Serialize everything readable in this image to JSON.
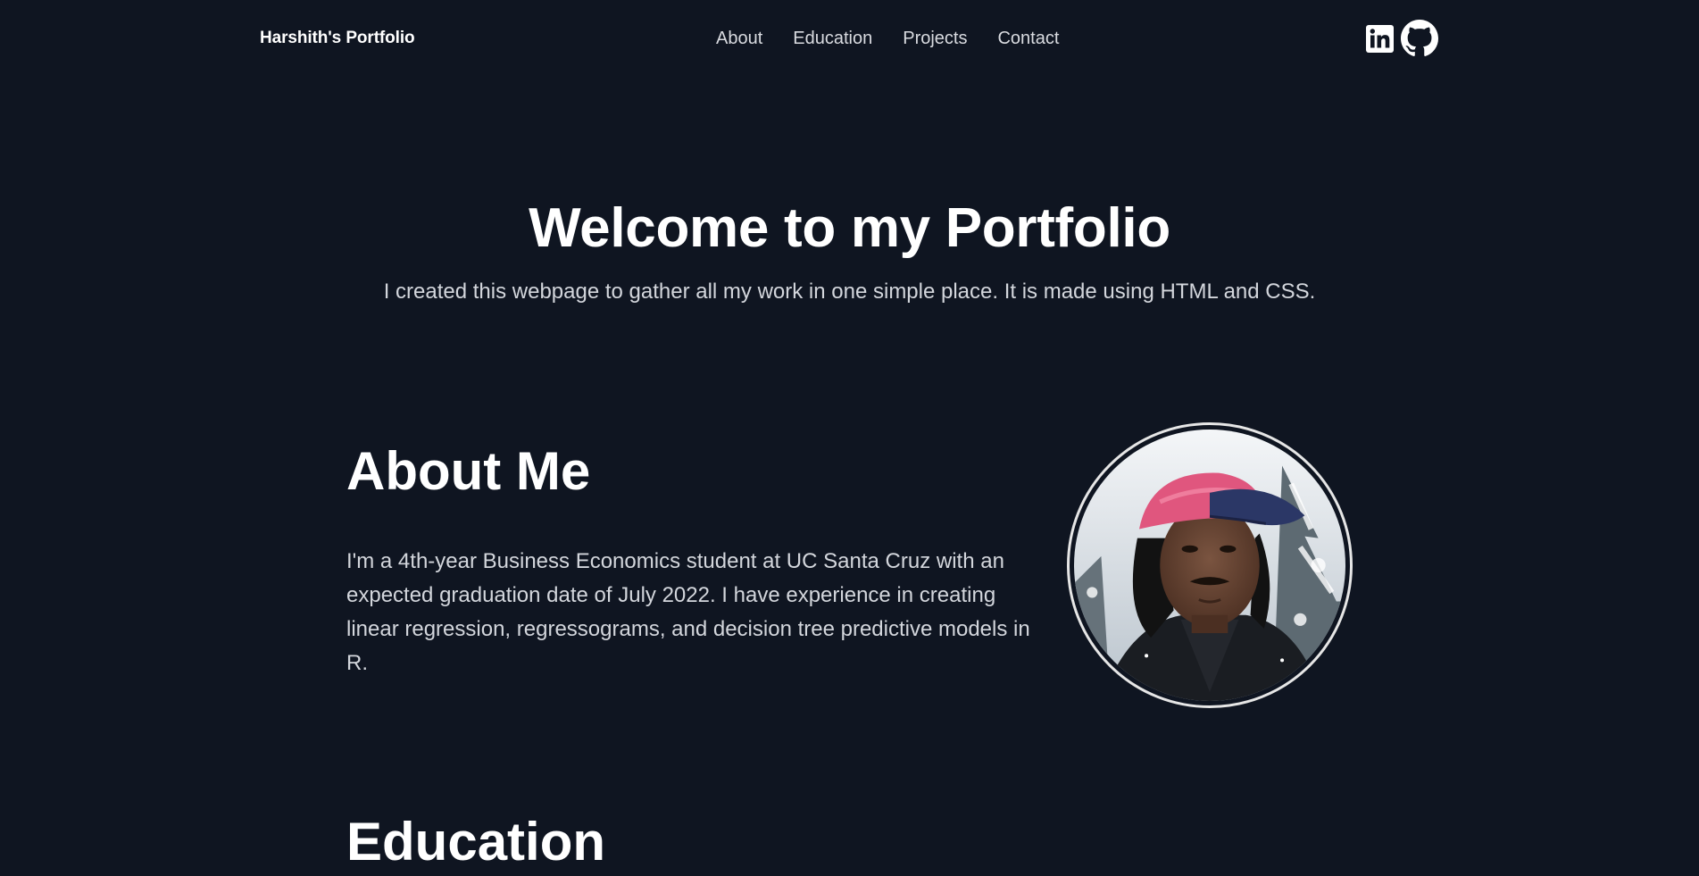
{
  "nav": {
    "brand": "Harshith's Portfolio",
    "links": [
      "About",
      "Education",
      "Projects",
      "Contact"
    ],
    "social": [
      "linkedin-icon",
      "github-icon"
    ]
  },
  "hero": {
    "title": "Welcome to my Portfolio",
    "subtitle": "I created this webpage to gather all my work in one simple place. It is made using HTML and CSS."
  },
  "about": {
    "title": "About Me",
    "text": "I'm a 4th-year Business Economics student at UC Santa Cruz with an expected graduation date of July 2022. I have experience in creating linear regression, regressograms, and decision tree predictive models in R."
  },
  "education": {
    "title": "Education"
  },
  "colors": {
    "background": "#0f1521",
    "text": "#ffffff",
    "muted_text": "#d3d6dc"
  }
}
